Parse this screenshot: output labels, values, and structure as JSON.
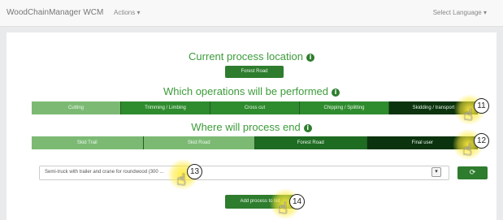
{
  "nav": {
    "brand": "WoodChainManager WCM",
    "actions": "Actions ▾",
    "language": "Select Language ▾"
  },
  "location": {
    "title": "Current process location",
    "button": "Forest Road"
  },
  "operations": {
    "title": "Which operations will be performed",
    "items": [
      {
        "label": "Cutting",
        "color": "#7cba74"
      },
      {
        "label": "Trimming / Limbing",
        "color": "#2e8b2e"
      },
      {
        "label": "Cross cut",
        "color": "#2e8b2e"
      },
      {
        "label": "Chipping / Splitting",
        "color": "#2e8b2e"
      },
      {
        "label": "Skidding / transport",
        "color": "#0a330e"
      }
    ]
  },
  "end": {
    "title": "Where will process end",
    "items": [
      {
        "label": "Skid Trail",
        "color": "#7cba74"
      },
      {
        "label": "Skid Road",
        "color": "#7cba74"
      },
      {
        "label": "Forest Road",
        "color": "#1e6b22"
      },
      {
        "label": "Final user",
        "color": "#0a330e"
      }
    ]
  },
  "machine_select": {
    "value": "Semi-truck with trailer and crane for roundwood (300 ..."
  },
  "add_button": "Add process to list",
  "markers": [
    "11",
    "12",
    "13",
    "14"
  ],
  "icons": {
    "info": "info-circle-icon",
    "refresh": "refresh-icon",
    "chevron": "chevron-down-icon",
    "pointer": "hand-pointer-icon"
  }
}
